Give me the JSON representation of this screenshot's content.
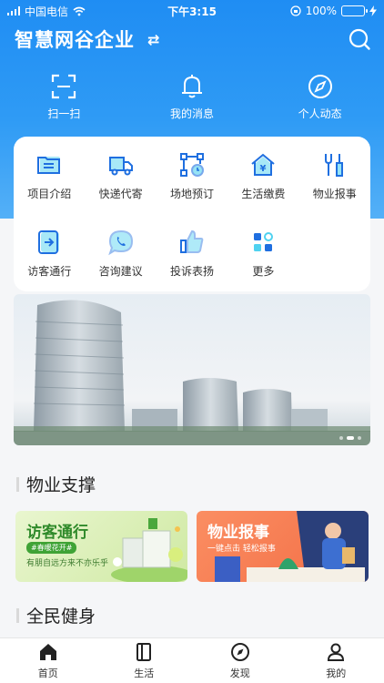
{
  "status_bar": {
    "carrier": "中国电信",
    "time": "下午3:15",
    "battery_percent": "100%",
    "battery_level": 1.0
  },
  "header": {
    "title": "智慧网谷企业",
    "swap_icon": "swap-icon",
    "search_icon": "search-icon"
  },
  "quick_actions": [
    {
      "label": "扫一扫",
      "icon": "scan-icon"
    },
    {
      "label": "我的消息",
      "icon": "bell-icon"
    },
    {
      "label": "个人动态",
      "icon": "compass-icon"
    }
  ],
  "services": [
    {
      "label": "项目介绍",
      "icon": "folder-list-icon"
    },
    {
      "label": "快递代寄",
      "icon": "delivery-truck-icon"
    },
    {
      "label": "场地预订",
      "icon": "venue-booking-icon"
    },
    {
      "label": "生活缴费",
      "icon": "house-yuan-icon"
    },
    {
      "label": "物业报事",
      "icon": "tools-icon"
    },
    {
      "label": "访客通行",
      "icon": "visitor-pass-icon"
    },
    {
      "label": "咨询建议",
      "icon": "chat-phone-icon"
    },
    {
      "label": "投诉表扬",
      "icon": "thumbs-up-icon"
    },
    {
      "label": "更多",
      "icon": "more-grid-icon"
    }
  ],
  "sections": {
    "property_support": "物业支撑",
    "fitness": "全民健身"
  },
  "promos": {
    "visitor": {
      "title": "访客通行",
      "tag": "#春暖花开#",
      "subtitle": "有朋自远方来不亦乐乎"
    },
    "repair": {
      "title": "物业报事",
      "subtitle": "一键点击 轻松报事"
    }
  },
  "tabs": [
    {
      "label": "首页",
      "icon": "home-icon"
    },
    {
      "label": "生活",
      "icon": "book-icon"
    },
    {
      "label": "发现",
      "icon": "compass-icon"
    },
    {
      "label": "我的",
      "icon": "user-icon"
    }
  ],
  "colors": {
    "header_blue": "#1f8df3",
    "icon_blue": "#1f6fe0",
    "icon_cyan": "#4fd2f0"
  }
}
